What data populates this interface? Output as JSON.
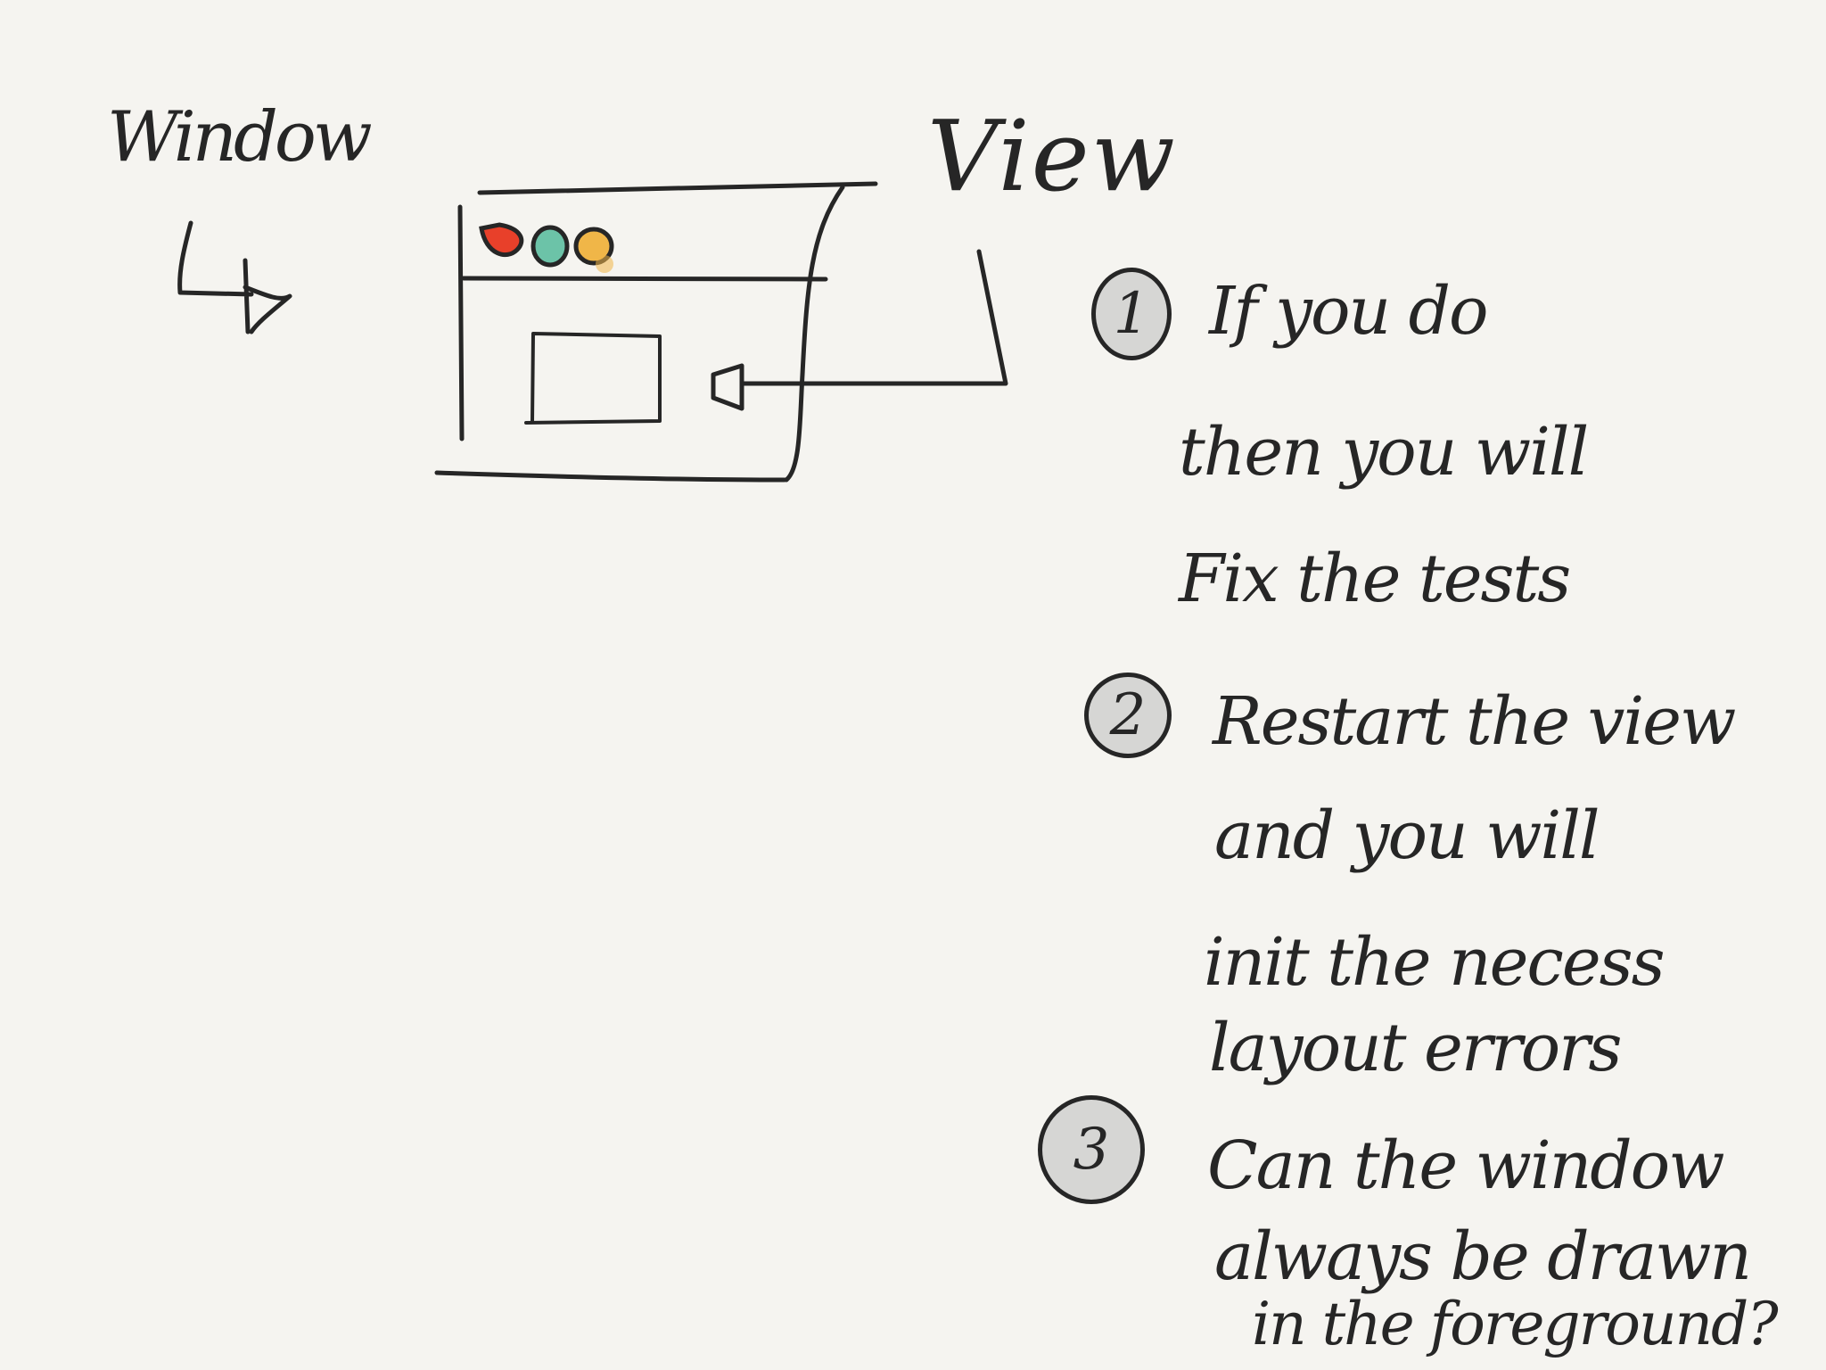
{
  "sketch": {
    "window_label": "Window",
    "view_label": "View",
    "traffic_light_colors": {
      "close": "#e8402a",
      "minimize": "#6cc3a8",
      "zoom": "#f0b648"
    },
    "ink_color": "#262626",
    "paper_color": "#f5f4f0"
  },
  "notes": [
    {
      "number": "1",
      "lines": [
        "If you do",
        "then you will",
        "Fix the  tests"
      ]
    },
    {
      "number": "2",
      "lines": [
        "Restart the view",
        "and  you will",
        "init the necess",
        "layout errors"
      ]
    },
    {
      "number": "3",
      "lines": [
        "Can the window",
        "always be drawn",
        "in the foreground?"
      ]
    }
  ]
}
